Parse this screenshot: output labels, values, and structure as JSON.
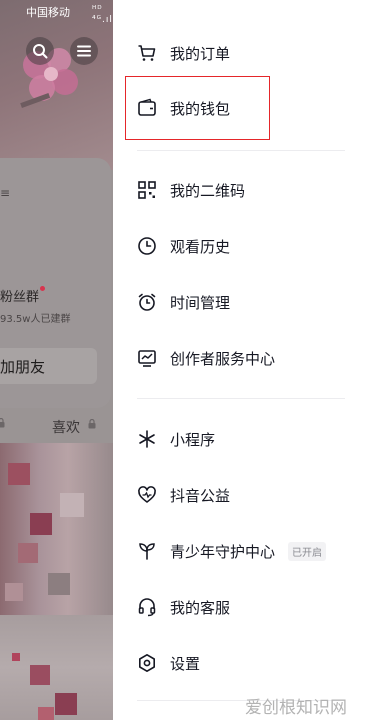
{
  "status_bar": {
    "carrier": "中国移动",
    "signal": "ᴴᴰ ⁴ᴳ.ıll"
  },
  "background": {
    "card_letter": "≡",
    "fans_title": "粉丝群",
    "fans_subtitle": "93.5w人已建群",
    "add_friend_label": "加朋友",
    "likes_label": "喜欢"
  },
  "menu": {
    "group1": [
      {
        "label": "我的订单",
        "icon": "cart-icon"
      },
      {
        "label": "我的钱包",
        "icon": "wallet-icon"
      }
    ],
    "group2": [
      {
        "label": "我的二维码",
        "icon": "qrcode-icon"
      },
      {
        "label": "观看历史",
        "icon": "clock-icon"
      },
      {
        "label": "时间管理",
        "icon": "alarm-icon"
      },
      {
        "label": "创作者服务中心",
        "icon": "chart-icon"
      }
    ],
    "group3": [
      {
        "label": "小程序",
        "icon": "asterisk-icon"
      },
      {
        "label": "抖音公益",
        "icon": "heart-icon"
      },
      {
        "label": "青少年守护中心",
        "icon": "sprout-icon",
        "badge": "已开启"
      },
      {
        "label": "我的客服",
        "icon": "headset-icon"
      },
      {
        "label": "设置",
        "icon": "settings-icon"
      }
    ]
  },
  "watermark": "爱创根知识网",
  "colors": {
    "highlight": "#e5262a",
    "text": "#161823"
  }
}
